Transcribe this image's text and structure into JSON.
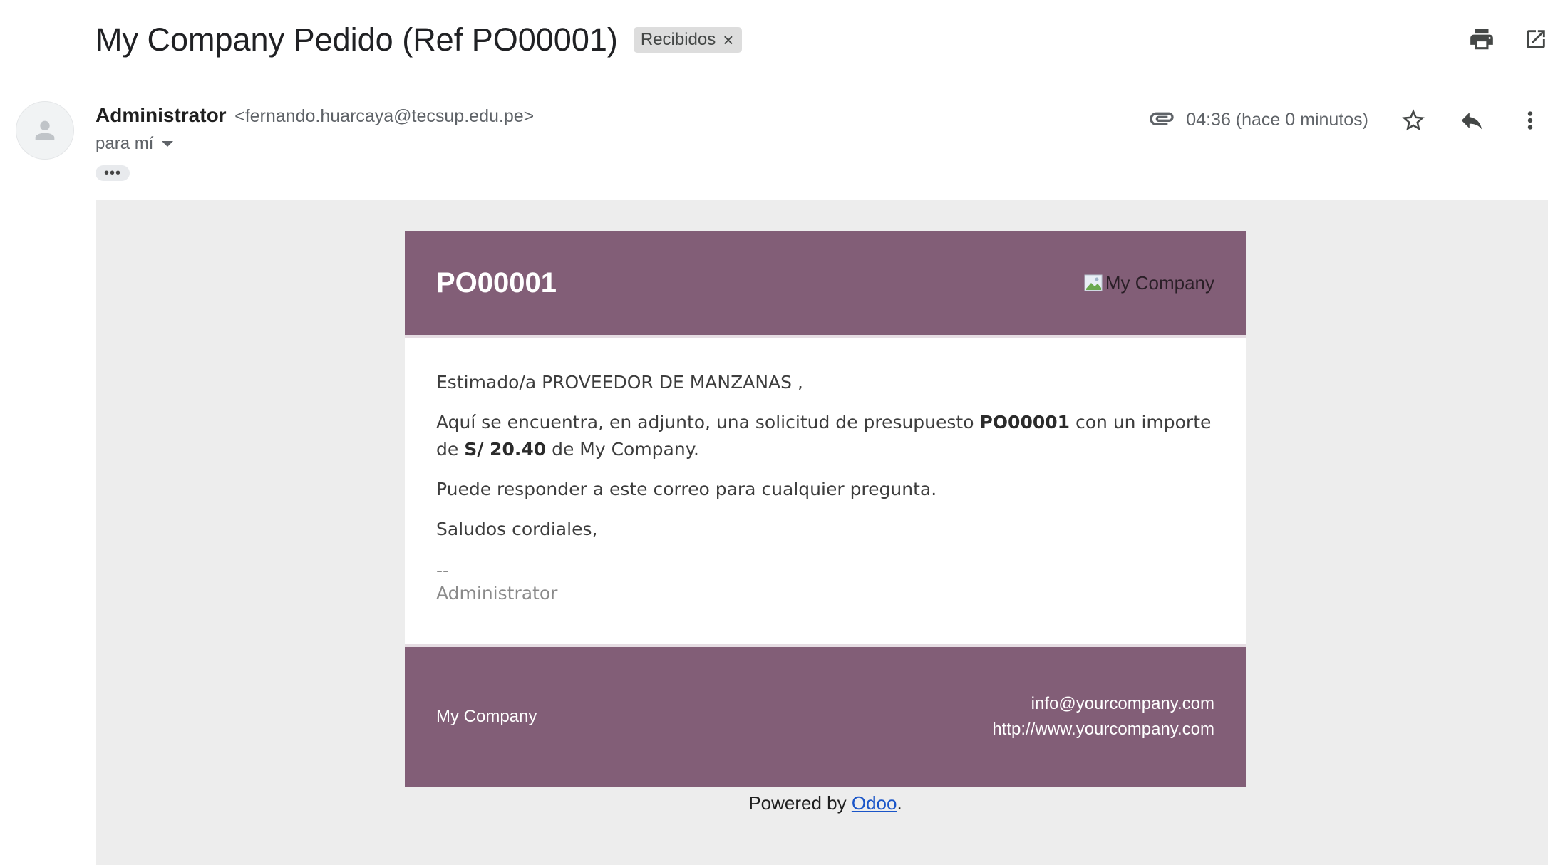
{
  "header": {
    "subject": "My Company Pedido (Ref PO00001)",
    "label": "Recibidos",
    "label_remove": "×",
    "icons": [
      "print-icon",
      "open-in-new-window-icon"
    ]
  },
  "sender": {
    "name": "Administrator",
    "email": "<fernando.huarcaya@tecsup.edu.pe>",
    "to": "para mí",
    "ellipsis": "•••",
    "time": "04:36 (hace 0 minutos)",
    "icons": [
      "attachment-icon",
      "star-icon",
      "reply-icon",
      "more-vert-icon"
    ]
  },
  "mail": {
    "title": "PO00001",
    "logo_alt": "My Company",
    "greeting": "Estimado/a PROVEEDOR DE MANZANAS ,",
    "p1_start": "Aquí se encuentra, en adjunto, una solicitud de presupuesto ",
    "p1_ref": "PO00001",
    "p1_mid": " con un importe de ",
    "p1_amount": "S/ 20.40",
    "p1_end": " de My Company.",
    "p2": "Puede responder a este correo para cualquier pregunta.",
    "p3": "Saludos cordiales,",
    "sig_dash": "--",
    "sig_name": "Administrator",
    "footer_company": "My Company",
    "footer_email": "info@yourcompany.com",
    "footer_web": "http://www.yourcompany.com",
    "powered_prefix": "Powered by ",
    "powered_link": "Odoo",
    "powered_suffix": "."
  },
  "colors": {
    "brand": "#825e77",
    "body_bg": "#ededed",
    "link": "#1a55c8"
  }
}
